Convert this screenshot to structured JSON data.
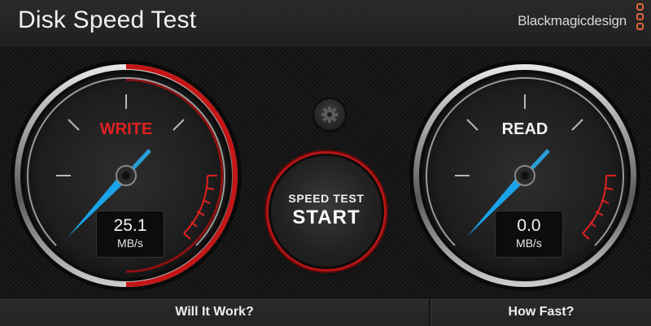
{
  "app": {
    "title": "Disk Speed Test",
    "brand": "Blackmagicdesign",
    "brand_color": "#e0683a"
  },
  "gauges": {
    "write": {
      "label": "WRITE",
      "label_color": "#e02020",
      "value": "25.1",
      "unit": "MB/s",
      "needle_color": "#1aa3e8",
      "progress_arc": "active"
    },
    "read": {
      "label": "READ",
      "label_color": "#f0f0f0",
      "value": "0.0",
      "unit": "MB/s",
      "needle_color": "#1aa3e8",
      "progress_arc": "inactive"
    }
  },
  "start_button": {
    "line1": "SPEED TEST",
    "line2": "START",
    "ring_color": "#b31515"
  },
  "settings": {
    "icon": "gear-icon"
  },
  "footer": {
    "will_it_work": "Will It Work?",
    "how_fast": "How Fast?"
  }
}
